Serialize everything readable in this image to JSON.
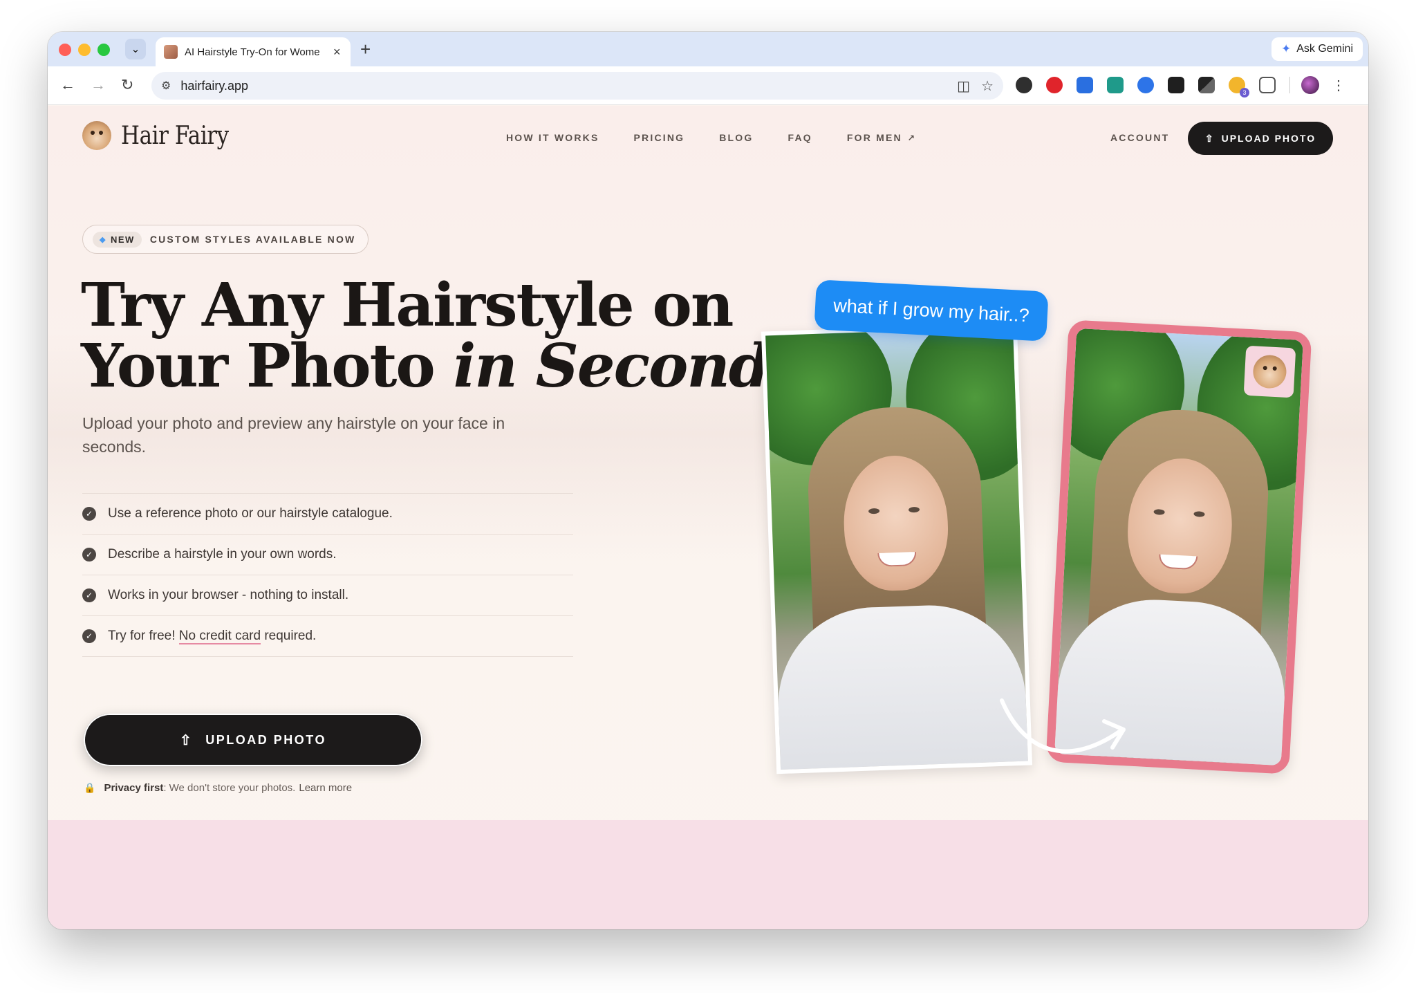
{
  "browser": {
    "tab_title": "AI Hairstyle Try-On for Wome",
    "new_tab_label": "+",
    "url": "hairfairy.app",
    "ask_gemini_label": "Ask Gemini",
    "extension_badge": "3"
  },
  "header": {
    "logo_text": "Hair Fairy",
    "nav": {
      "how_it_works": "HOW IT WORKS",
      "pricing": "PRICING",
      "blog": "BLOG",
      "faq": "FAQ",
      "for_men": "FOR MEN"
    },
    "account": "ACCOUNT",
    "upload_button": "UPLOAD PHOTO"
  },
  "hero": {
    "badge_new": "NEW",
    "badge_text": "CUSTOM STYLES AVAILABLE NOW",
    "headline_line1": "Try Any Hairstyle on",
    "headline_line2_plain": "Your Photo ",
    "headline_line2_italic": "in Seconds",
    "subhead": "Upload your photo and preview any hairstyle on your face in seconds.",
    "features": [
      {
        "text": "Use a reference photo or our hairstyle catalogue."
      },
      {
        "text": "Describe a hairstyle in your own words."
      },
      {
        "text": "Works in your browser - nothing to install."
      }
    ],
    "feature_free_prefix": "Try for free! ",
    "feature_free_link": "No credit card",
    "feature_free_suffix": " required.",
    "upload_button": "UPLOAD PHOTO",
    "privacy_strong": "Privacy first",
    "privacy_text": ": We don't store your photos.",
    "privacy_learn": "Learn more",
    "speech_bubble": "what if I grow my hair..?"
  },
  "colors": {
    "accent_pink": "#e87a8c",
    "bubble_blue": "#1d8cf5",
    "button_dark": "#1c1a1a"
  }
}
